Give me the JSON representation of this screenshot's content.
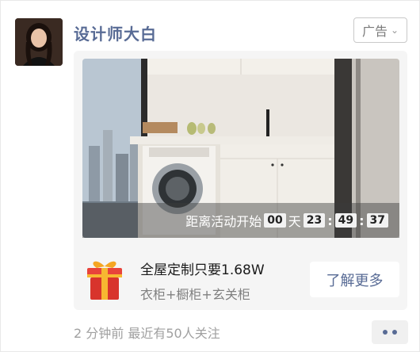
{
  "post": {
    "author": "设计师大白",
    "ad_label": "广告",
    "meta": "2 分钟前 最近有50人关注"
  },
  "countdown": {
    "prefix": "距离活动开始",
    "days": "00",
    "day_unit": "天",
    "hours": "23",
    "minutes": "49",
    "seconds": "37"
  },
  "offer": {
    "title": "全屋定制只要1.68W",
    "subtitle": "衣柜+橱柜+玄关柜",
    "cta_label": "了解更多"
  },
  "colors": {
    "link": "#586b95",
    "card_bg": "#f5f5f5"
  },
  "icons": {
    "ad_menu": "chevron-down-icon",
    "more": "more-dots-icon",
    "gift": "gift-box-icon"
  }
}
